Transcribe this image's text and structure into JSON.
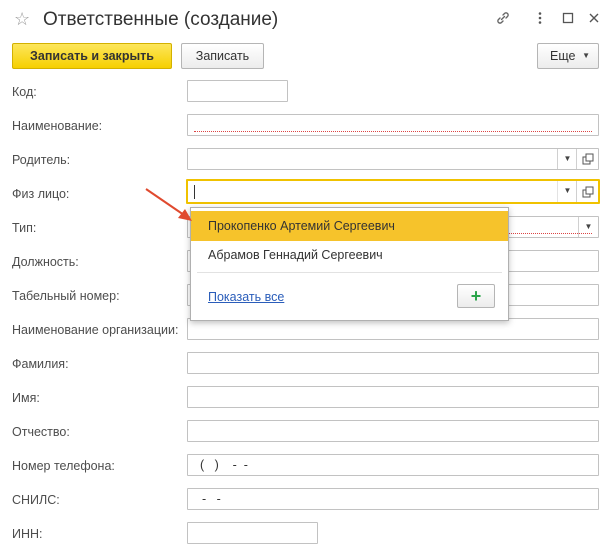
{
  "window": {
    "title": "Ответственные (создание)"
  },
  "toolbar": {
    "save_close_label": "Записать и закрыть",
    "save_label": "Записать",
    "more_label": "Еще"
  },
  "form": {
    "code_label": "Код:",
    "code_value": "",
    "name_label": "Наименование:",
    "parent_label": "Родитель:",
    "person_label": "Физ лицо:",
    "type_label": "Тип:",
    "position_label": "Должность:",
    "tabnum_label": "Табельный номер:",
    "org_label": "Наименование организации:",
    "surname_label": "Фамилия:",
    "firstname_label": "Имя:",
    "patronymic_label": "Отчество:",
    "phone_label": "Номер телефона:",
    "phone_mask": "(   )    -  -",
    "snils_label": "СНИЛС:",
    "snils_mask": "-   -",
    "inn_label": "ИНН:"
  },
  "dropdown": {
    "items": [
      {
        "label": "Прокопенко Артемий Сергеевич",
        "selected": true
      },
      {
        "label": "Абрамов Геннадий Сергеевич",
        "selected": false
      }
    ],
    "show_all_label": "Показать все",
    "add_icon": "plus-icon"
  },
  "colors": {
    "accent": "#f6d000",
    "selection": "#f6c32b",
    "link": "#2a5dba",
    "arrow": "#e04a2f",
    "add": "#2aa44a"
  }
}
